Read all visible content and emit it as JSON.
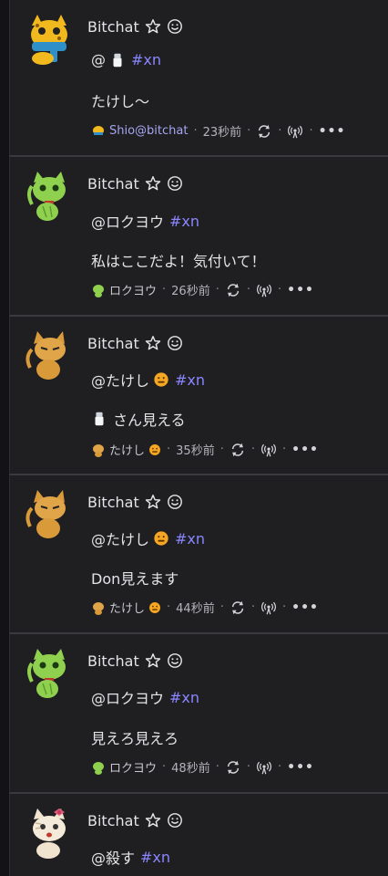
{
  "colors": {
    "background": "#1f1f22",
    "hashtag": "#8a86ff",
    "separator": "#3a3a3f"
  },
  "posts": [
    {
      "name": "Bitchat",
      "mention": "@",
      "mention_emoji": "salt-shaker",
      "hashtag": "#xn",
      "body": "たけし〜",
      "meta_author": "Shio@bitchat",
      "meta_time": "23秒前",
      "avatar": "cat-yellow-scarf"
    },
    {
      "name": "Bitchat",
      "mention": "@ロクヨウ",
      "hashtag": "#xn",
      "body": "私はここだよ！気付いて！",
      "meta_author": "ロクヨウ",
      "meta_time": "26秒前",
      "avatar": "cat-green"
    },
    {
      "name": "Bitchat",
      "mention": "@たけし",
      "mention_emoji": "face",
      "hashtag": "#xn",
      "body": "さん見える",
      "body_emoji": "salt-shaker",
      "meta_author": "たけし",
      "meta_time": "35秒前",
      "avatar": "cat-orange"
    },
    {
      "name": "Bitchat",
      "mention": "@たけし",
      "mention_emoji": "face",
      "hashtag": "#xn",
      "body": "Don見えます",
      "meta_author": "たけし",
      "meta_time": "44秒前",
      "avatar": "cat-orange"
    },
    {
      "name": "Bitchat",
      "mention": "@ロクヨウ",
      "hashtag": "#xn",
      "body": "見えろ見えろ",
      "meta_author": "ロクヨウ",
      "meta_time": "48秒前",
      "avatar": "cat-green"
    },
    {
      "name": "Bitchat",
      "mention": "@殺す",
      "hashtag": "#xn",
      "avatar": "cat-white-bow"
    }
  ]
}
